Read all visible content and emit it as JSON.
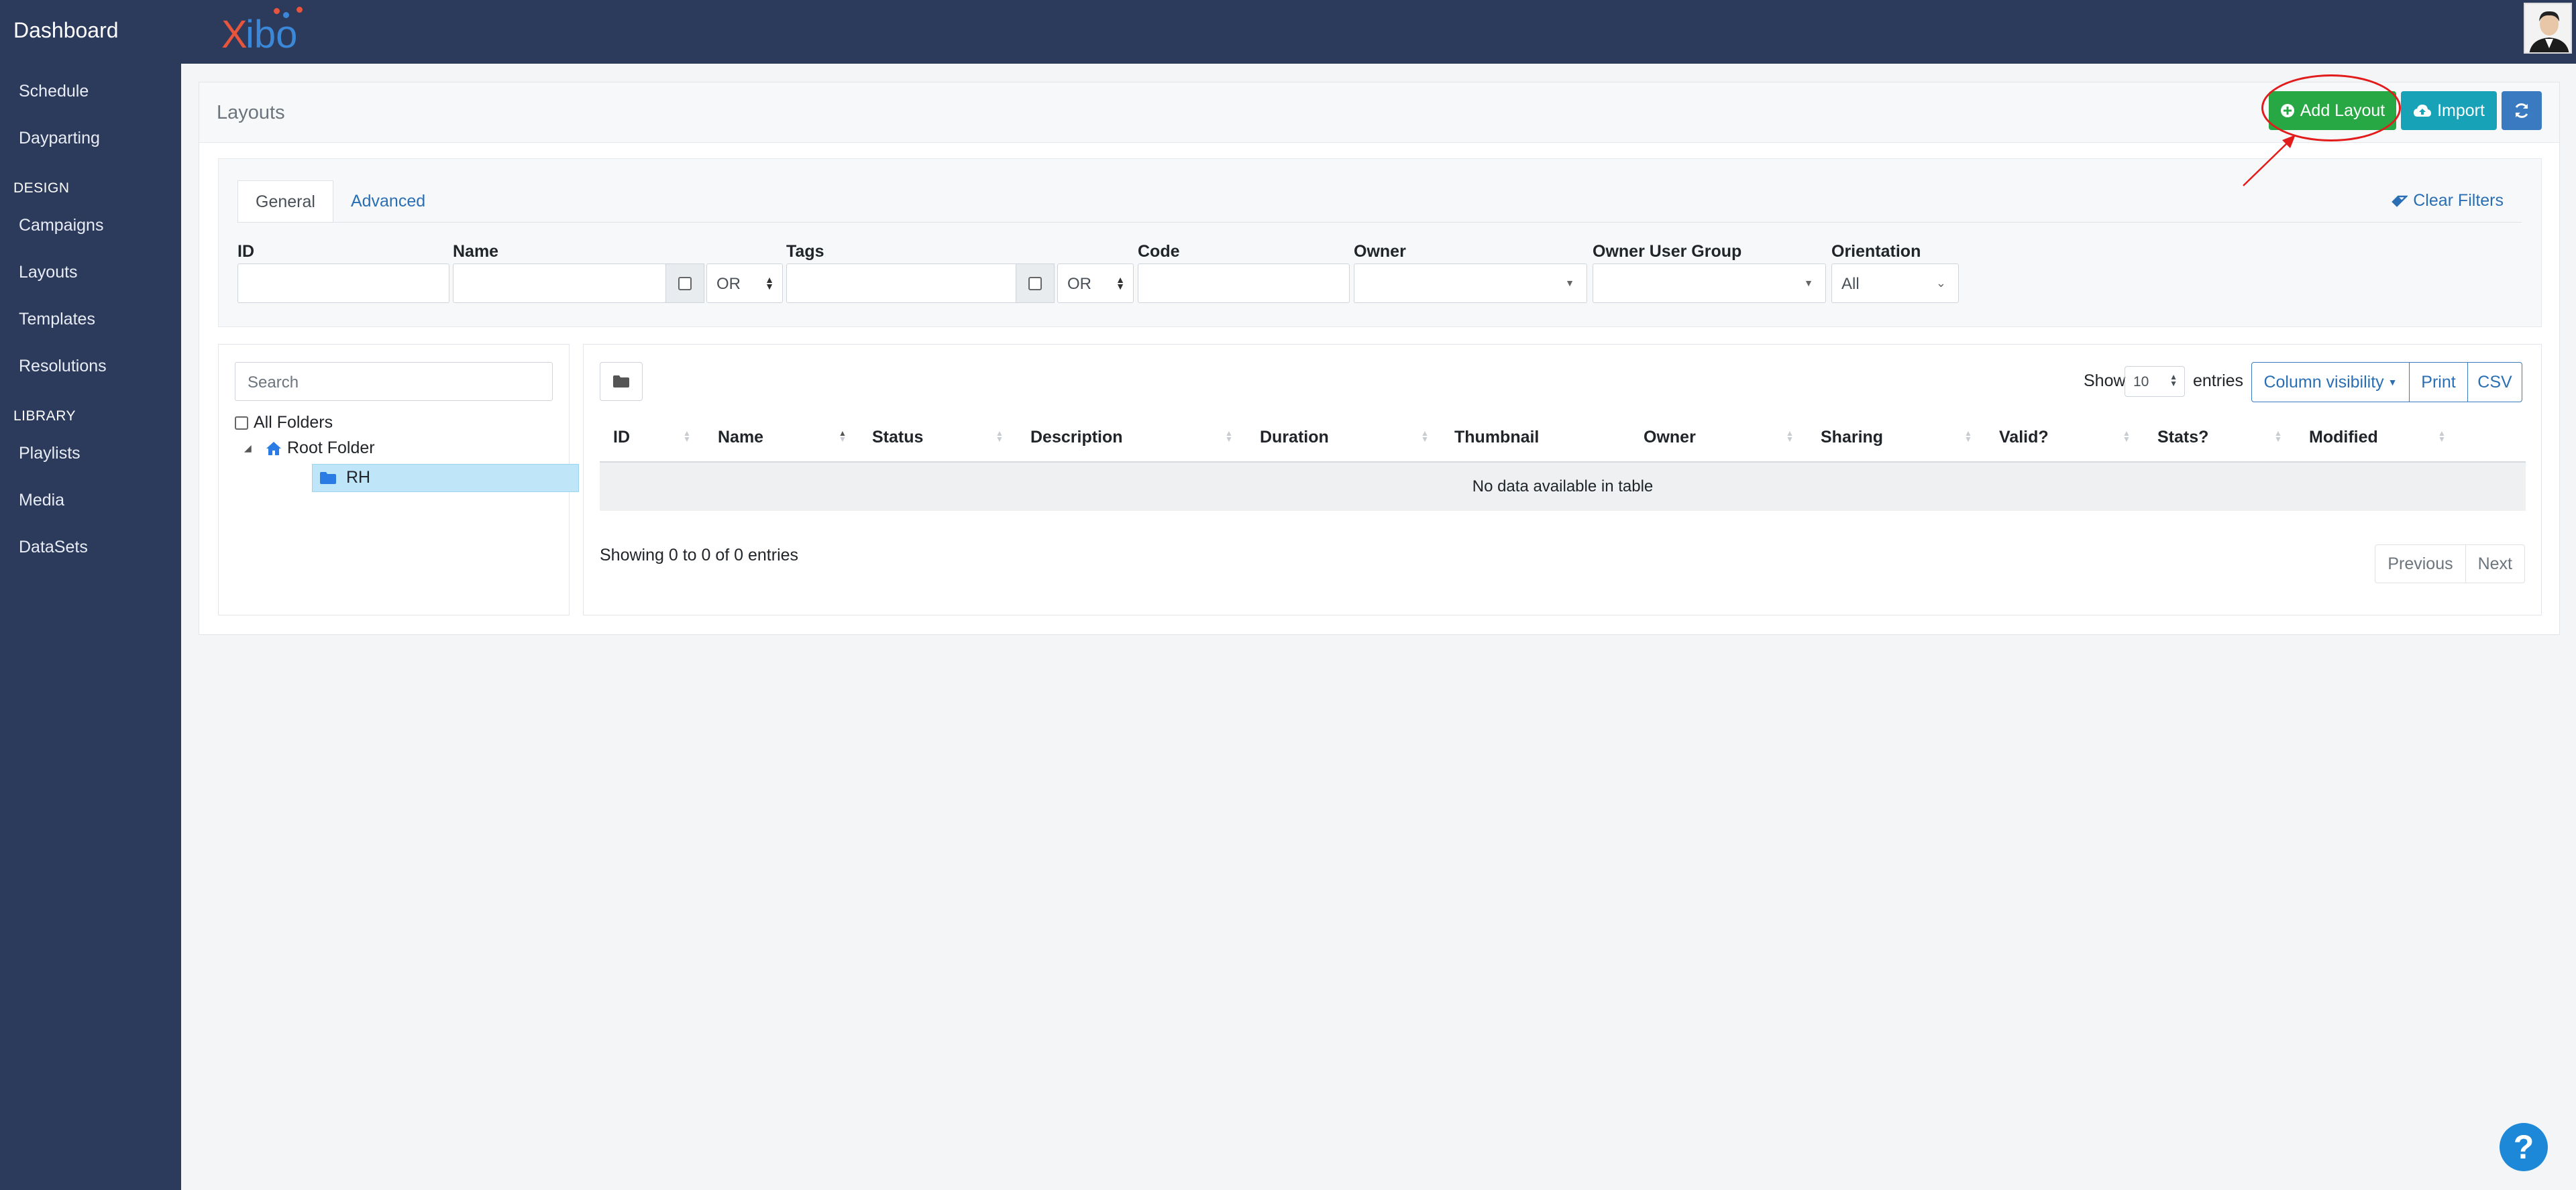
{
  "topbar": {
    "brand": "Dashboard",
    "logo_x": "X",
    "logo_rest": "ibo"
  },
  "sidebar": {
    "items_top": [
      "Schedule",
      "Dayparting"
    ],
    "design_heading": "DESIGN",
    "design_items": [
      "Campaigns",
      "Layouts",
      "Templates",
      "Resolutions"
    ],
    "library_heading": "LIBRARY",
    "library_items": [
      "Playlists",
      "Media",
      "DataSets"
    ]
  },
  "page": {
    "title": "Layouts",
    "add_label": "Add Layout",
    "import_label": "Import"
  },
  "filters": {
    "tabs": [
      "General",
      "Advanced"
    ],
    "clear_label": "Clear Filters",
    "labels": {
      "id": "ID",
      "name": "Name",
      "tags": "Tags",
      "code": "Code",
      "owner": "Owner",
      "owner_group": "Owner User Group",
      "orientation": "Orientation"
    },
    "name_operator": "OR",
    "tags_operator": "OR",
    "orientation_value": "All"
  },
  "tree": {
    "search_placeholder": "Search",
    "all_folders": "All Folders",
    "root": "Root Folder",
    "child": "RH"
  },
  "table": {
    "show_label": "Show",
    "page_length": "10",
    "entries_label": "entries",
    "column_visibility": "Column visibility",
    "print": "Print",
    "csv": "CSV",
    "columns": [
      "ID",
      "Name",
      "Status",
      "Description",
      "Duration",
      "Thumbnail",
      "Owner",
      "Sharing",
      "Valid?",
      "Stats?",
      "Modified"
    ],
    "empty": "No data available in table",
    "info": "Showing 0 to 0 of 0 entries",
    "prev": "Previous",
    "next": "Next"
  },
  "help": "?"
}
